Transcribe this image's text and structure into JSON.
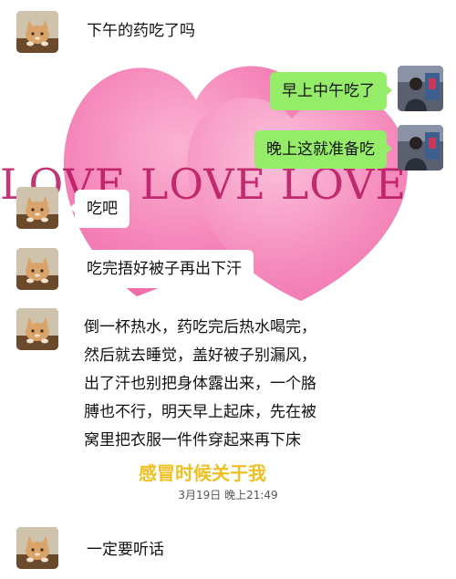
{
  "background": {
    "love_text": "LOVE LOVE LOVE",
    "heart_color": "#f47fb6"
  },
  "messages": [
    {
      "side": "left",
      "text": "下午的药吃了吗"
    },
    {
      "side": "right",
      "text": "早上中午吃了"
    },
    {
      "side": "right",
      "text": "晚上这就准备吃"
    },
    {
      "side": "left",
      "text": "吃吧"
    },
    {
      "side": "left",
      "text": "吃完捂好被子再出下汗"
    },
    {
      "side": "left",
      "lines": [
        "倒一杯热水，药吃完后热水喝完，",
        "然后就去睡觉，盖好被子别漏风，",
        "出了汗也别把身体露出来，一个胳",
        "膊也不行，明天早上起床，先在被",
        "窝里把衣服一件件穿起来再下床"
      ]
    },
    {
      "side": "left",
      "text": "一定要听话"
    }
  ],
  "caption": "感冒时候关于我",
  "timestamp": "3月19日 晚上21:49",
  "colors": {
    "sent_bubble": "#95ec69",
    "received_bubble": "#ffffff",
    "caption": "#f0c020"
  },
  "icons": {
    "left_avatar": "cat-avatar-icon",
    "right_avatar": "person-photo-avatar-icon"
  }
}
